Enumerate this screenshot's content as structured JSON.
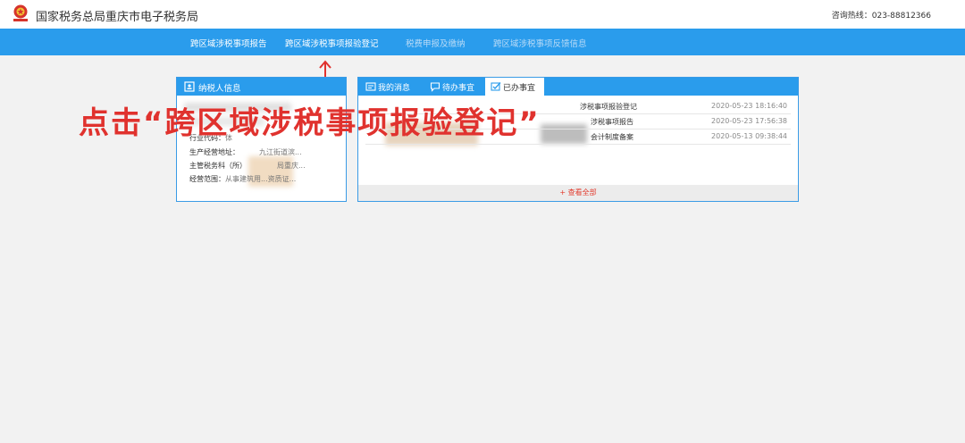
{
  "header": {
    "site_title": "国家税务总局重庆市电子税务局",
    "hotline": "咨询热线：023-88812366",
    "emblem_icon": "tax-emblem-icon"
  },
  "nav": {
    "items": [
      {
        "label": "跨区域涉税事项报告"
      },
      {
        "label": "跨区域涉税事项报验登记"
      },
      {
        "label": "税费申报及缴纳"
      },
      {
        "label": "跨区域涉税事项反馈信息"
      }
    ]
  },
  "taxpayer_panel": {
    "title": "纳税人信息",
    "rows": [
      {
        "label": "行业代码：",
        "value": "体"
      },
      {
        "label": "生产经营地址：",
        "value": "九江街道滨..."
      },
      {
        "label": "主管税务科（所）",
        "value": "局重庆..."
      },
      {
        "label": "经营范围：",
        "value": "从事建筑用...资质证..."
      }
    ]
  },
  "messages_panel": {
    "tabs": [
      {
        "label": "我的消息"
      },
      {
        "label": "待办事宜"
      },
      {
        "label": "已办事宜"
      }
    ],
    "rows": [
      {
        "title": "涉税事项报验登记",
        "time": "2020-05-23 18:16:40"
      },
      {
        "title": "涉税事项报告",
        "time": "2020-05-23 17:56:38"
      },
      {
        "title": "会计制度备案",
        "time": "2020-05-13 09:38:44"
      }
    ],
    "view_all": "+ 查看全部"
  },
  "annotation": {
    "text": "点击“跨区域涉税事项报验登记”",
    "arrow": "↑"
  },
  "colors": {
    "nav_bg": "#2a9cec",
    "annotation": "#e0322e",
    "page_bg": "#f2f2f2"
  }
}
